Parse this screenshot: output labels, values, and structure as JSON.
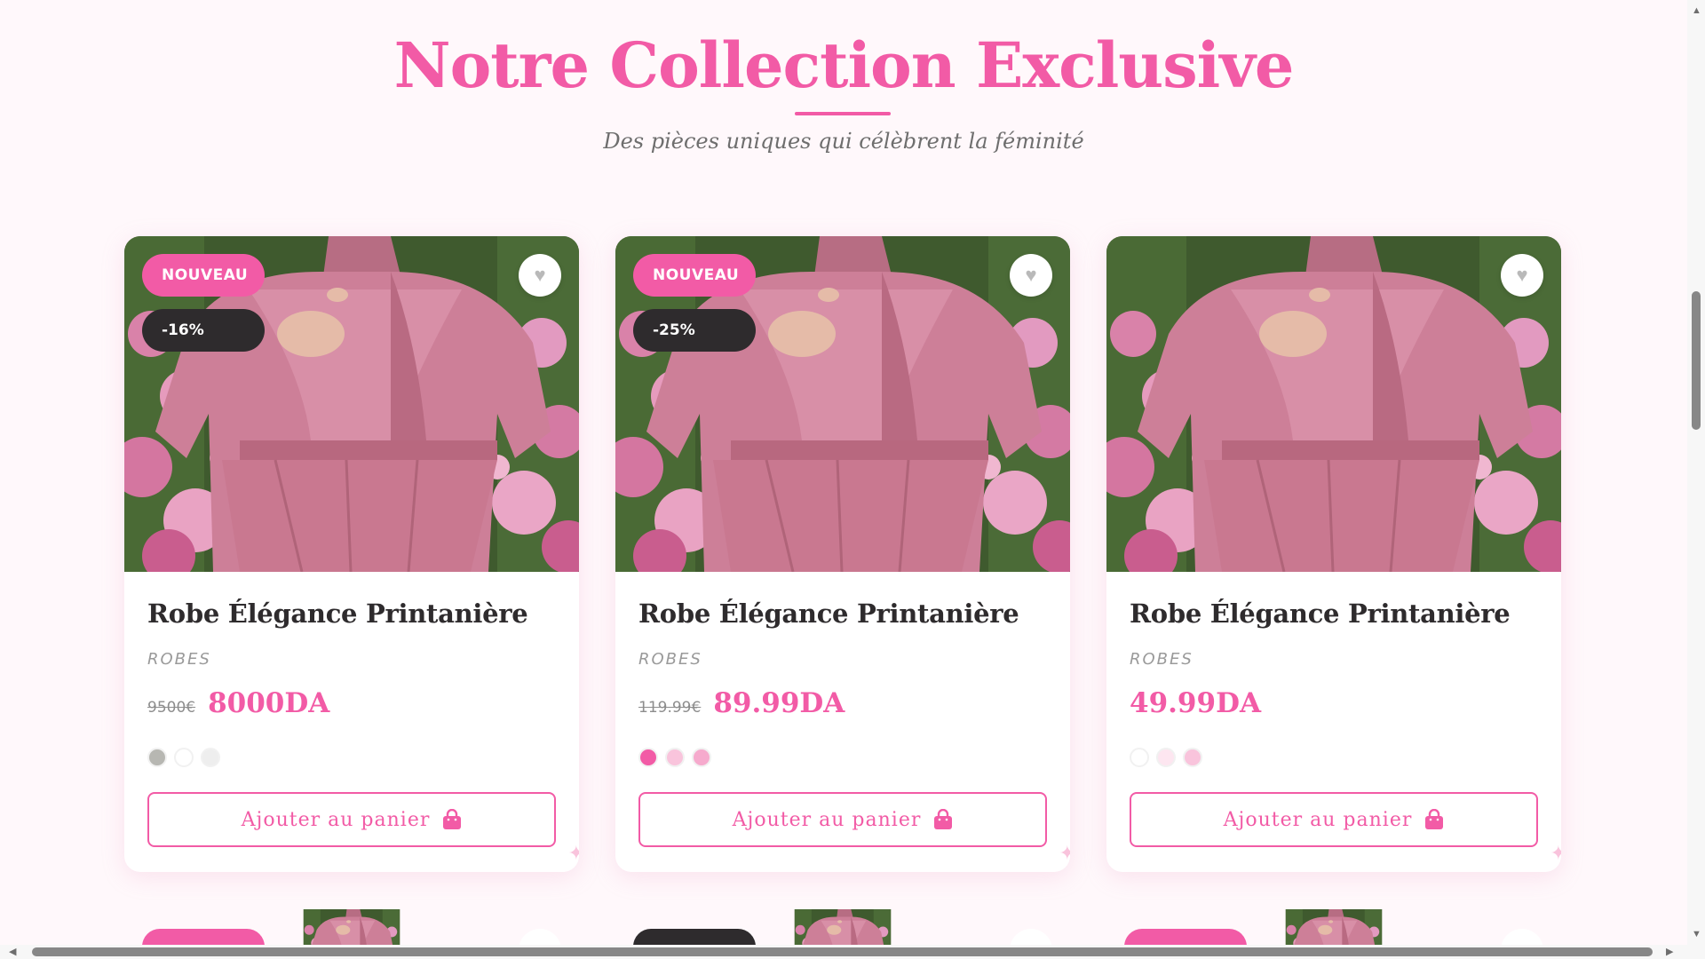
{
  "section": {
    "title": "Notre Collection Exclusive",
    "subtitle": "Des pièces uniques qui célèbrent la féminité"
  },
  "colors": {
    "accent": "#f25ba6",
    "dark_badge": "#2e2b2d",
    "background": "#fff8fb"
  },
  "icons": {
    "favorite": "heart-icon",
    "cart": "shopping-bag-icon",
    "decor": "sparkle-icon"
  },
  "products": [
    {
      "badge_new": "NOUVEAU",
      "badge_discount": "-16%",
      "name": "Robe Élégance Printanière",
      "category": "ROBES",
      "old_price": "9500€",
      "price": "8000DA",
      "colors": [
        "#b7b7b2",
        "#ffffff",
        "#eeeeee"
      ],
      "cta": "Ajouter au panier"
    },
    {
      "badge_new": "NOUVEAU",
      "badge_discount": "-25%",
      "name": "Robe Élégance Printanière",
      "category": "ROBES",
      "old_price": "119.99€",
      "price": "89.99DA",
      "colors": [
        "#f25ba6",
        "#f9c4dc",
        "#f6aacd"
      ],
      "cta": "Ajouter au panier"
    },
    {
      "name": "Robe Élégance Printanière",
      "category": "ROBES",
      "price": "49.99DA",
      "colors": [
        "#ffffff",
        "#fde6f0",
        "#f9c4dc"
      ],
      "cta": "Ajouter au panier"
    }
  ]
}
